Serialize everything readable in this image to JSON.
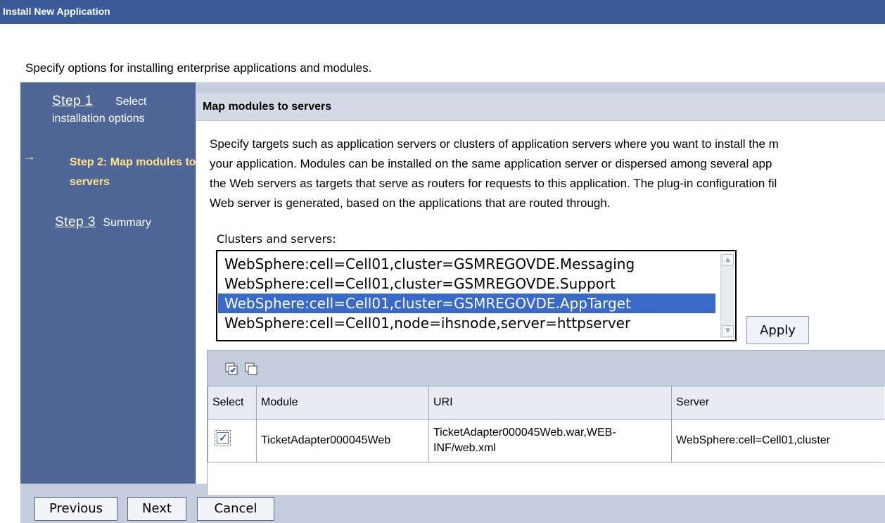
{
  "window": {
    "title": "Install New Application"
  },
  "intro": "Specify options for installing enterprise applications and modules.",
  "wizard": {
    "steps": [
      {
        "link": "Step 1",
        "label": "Select installation options"
      },
      {
        "label": "Step 2: Map modules to servers",
        "current": true
      },
      {
        "link": "Step 3",
        "label": "Summary"
      }
    ]
  },
  "main": {
    "heading": "Map modules to servers",
    "description": [
      "Specify targets such as application servers or clusters of application servers where you want to install the m",
      "your application. Modules can be installed on the same application server or dispersed among several app",
      "the Web servers as targets that serve as routers for requests to this application. The plug-in configuration fil",
      "Web server is generated, based on the applications that are routed through."
    ],
    "clusters_label": "Clusters and servers:",
    "clusters": [
      "WebSphere:cell=Cell01,cluster=GSMREGOVDE.Messaging",
      "WebSphere:cell=Cell01,cluster=GSMREGOVDE.Support",
      "WebSphere:cell=Cell01,cluster=GSMREGOVDE.AppTarget",
      "WebSphere:cell=Cell01,node=ihsnode,server=httpserver"
    ],
    "selected_cluster_index": 2,
    "apply_label": "Apply",
    "table": {
      "columns": [
        "Select",
        "Module",
        "URI",
        "Server"
      ],
      "rows": [
        {
          "selected": true,
          "module": "TicketAdapter000045Web",
          "uri_line1": "TicketAdapter000045Web.war,WEB-",
          "uri_line2": "INF/web.xml",
          "server": "WebSphere:cell=Cell01,cluster"
        }
      ]
    }
  },
  "footer": {
    "previous": "Previous",
    "next": "Next",
    "cancel": "Cancel"
  },
  "colors": {
    "titlebar": "#3a5a9a",
    "sidebar": "#4f6696",
    "selection": "#3a6ac8",
    "current_step": "#ffe38a"
  }
}
